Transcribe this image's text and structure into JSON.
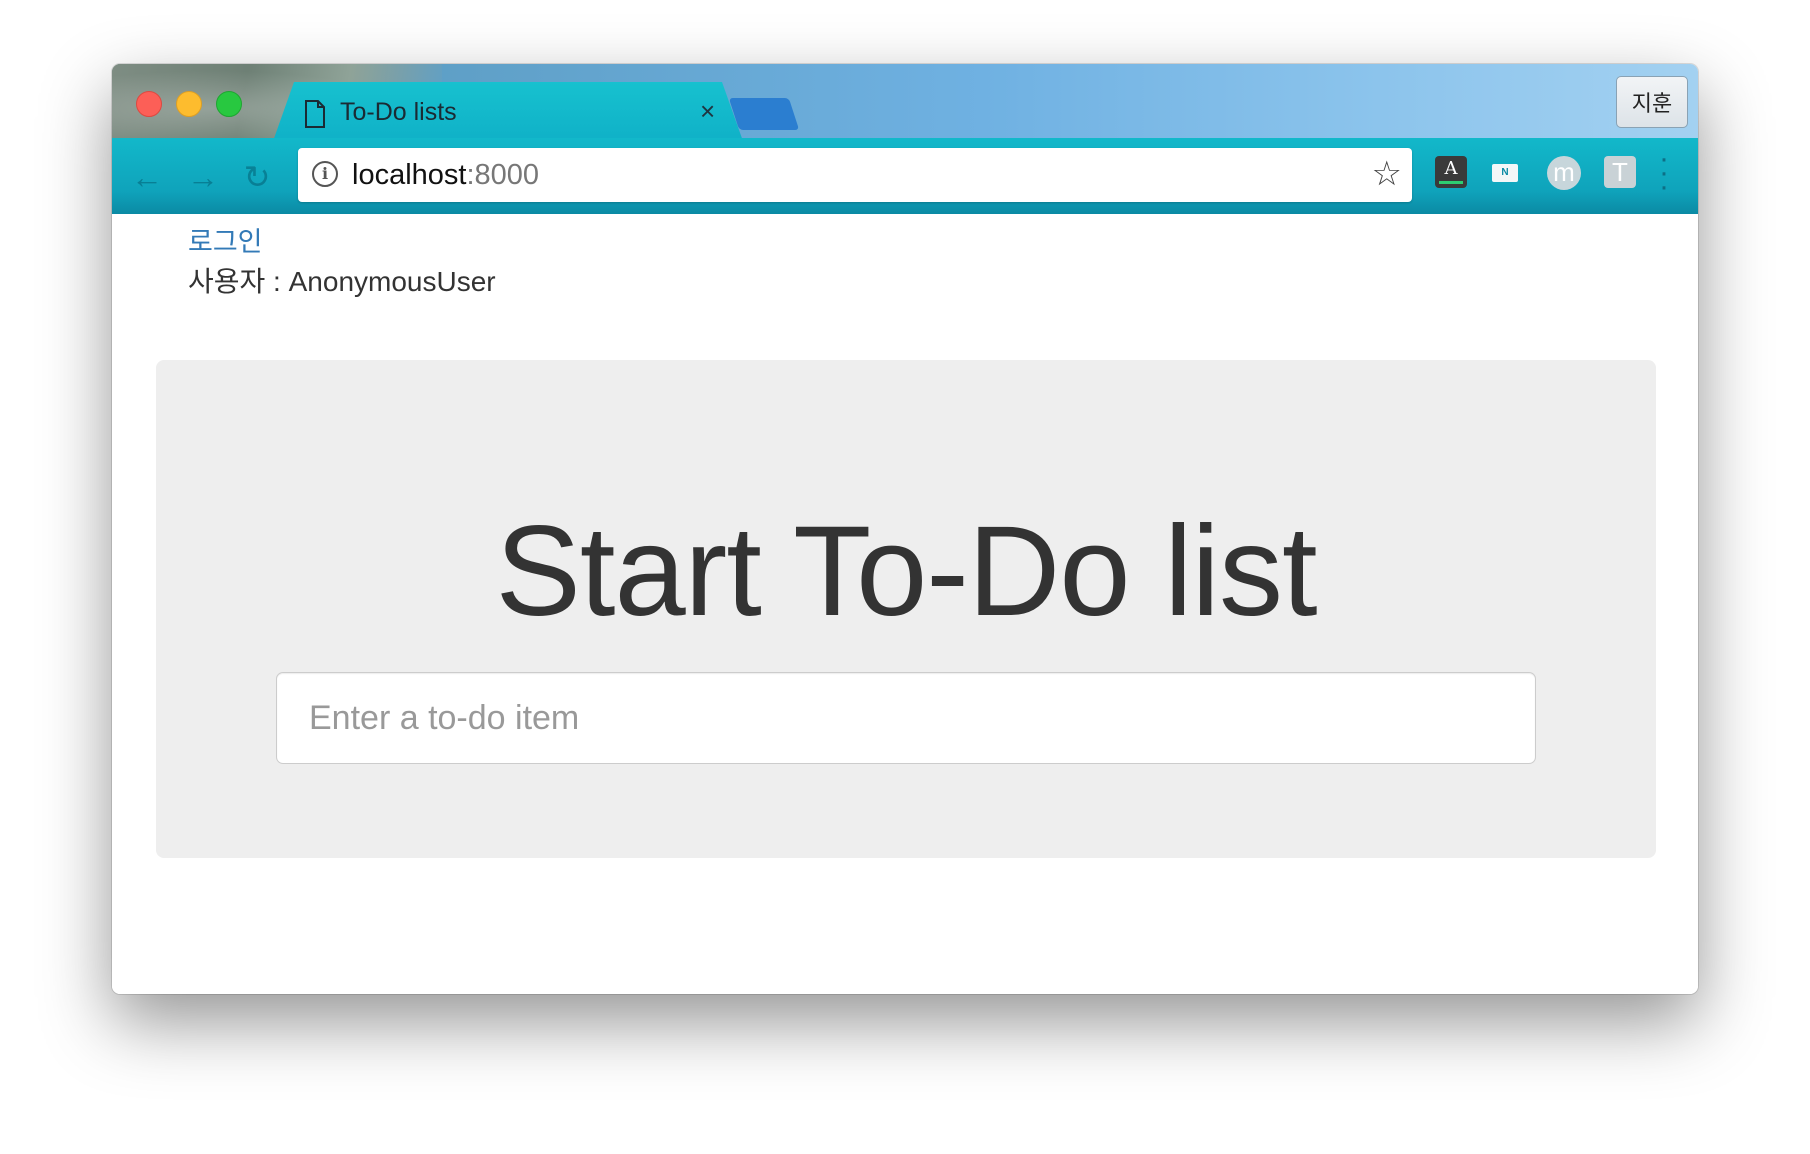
{
  "browser": {
    "tab": {
      "title": "To-Do lists",
      "close_glyph": "×"
    },
    "profile_name": "지훈",
    "address_bar": {
      "host": "localhost",
      "port": ":8000"
    },
    "extensions": [
      "A",
      "N",
      "m",
      "T"
    ],
    "icons": {
      "back": "back-arrow-icon",
      "forward": "forward-arrow-icon",
      "reload": "reload-icon",
      "info": "info-icon",
      "bookmark": "star-icon",
      "menu": "menu-dots-icon"
    }
  },
  "page": {
    "login_link": "로그인",
    "user_line": "사용자 : AnonymousUser",
    "heading": "Start To-Do list",
    "new_item_input": {
      "placeholder": "Enter a to-do item",
      "value": ""
    }
  },
  "colors": {
    "link": "#337ab7",
    "jumbotron_bg": "#eeeeee",
    "heading_text": "#333333",
    "toolbar": "#12b8ca"
  }
}
